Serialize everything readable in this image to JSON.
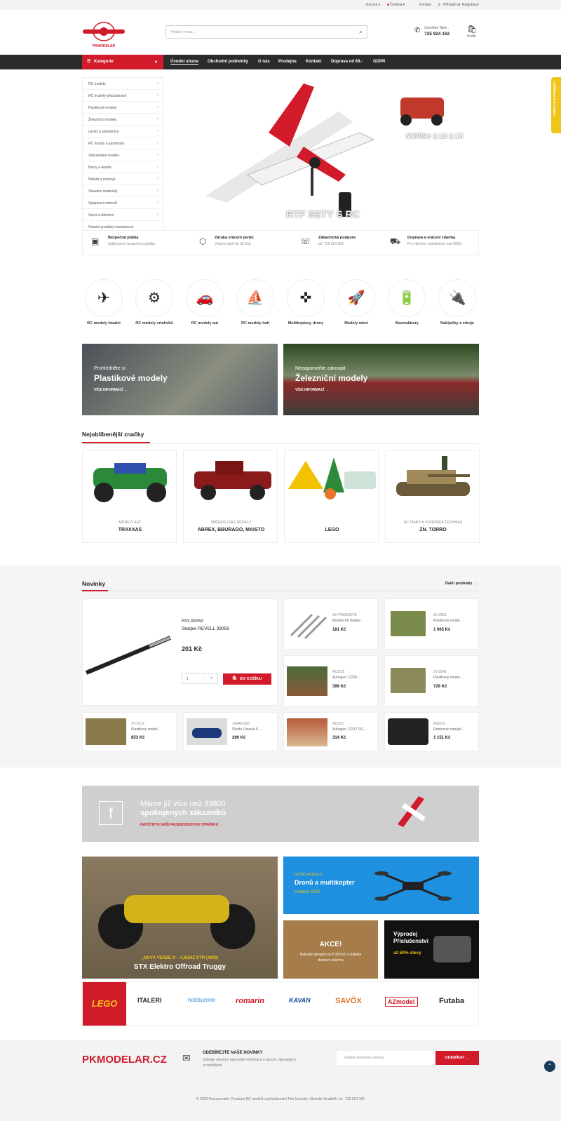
{
  "topbar": {
    "currency": "Koruna",
    "language": "Čeština",
    "contact": "Kontakt",
    "login": "Přihlásit se",
    "separator": "/",
    "register": "Registrace"
  },
  "header": {
    "logo_text": "PKMODELAR",
    "search_placeholder": "Hledaný výraz...",
    "phone_label": "Zavolejte Nám :",
    "phone": "725 924 162",
    "cart_label": "Košík"
  },
  "nav": {
    "categories_label": "Kategorie",
    "items": [
      "Úvodní strana",
      "Obchodní podmínky",
      "O nás",
      "Prodejna",
      "Kontakt",
      "Doprava od 69,-",
      "GDPR"
    ]
  },
  "sidemenu": [
    "RC modely",
    "RC modely-příslušenství",
    "Plastikové modely",
    "Železniční modely",
    "LEGO a stavebnice",
    "RC hračky a autodráhy",
    "Sběratelské modely",
    "Barvy a lepidla",
    "Nářadí a nástroje",
    "Stavební materiály",
    "Spojovací materiál",
    "Sport a oblečení",
    "Ostatní produkty-nezařazené"
  ],
  "hero": {
    "caption": "RTF SETY S RC",
    "side_caption": "Měřítko 1:12-1:18"
  },
  "features": [
    {
      "title": "Bezpečná platba",
      "text": "Zajišťujeme bezpečnou platbu"
    },
    {
      "title": "Záruka vrácení peněz",
      "text": "Vrácení zpět do 30 dnů"
    },
    {
      "title": "Zákaznická podpora",
      "text": "tel: 725 924 162"
    },
    {
      "title": "Doprava a vrácení zdarma",
      "text": "Pro všechny objednávky nad 5000,-"
    }
  ],
  "categories": [
    "RC modely letadel",
    "RC modely vrtulníků",
    "RC modely aut",
    "RC modely lodí",
    "Multikoptery, drony",
    "Modely raket",
    "Akumulátory",
    "Nabíječky a zdroje"
  ],
  "banners": [
    {
      "pre": "Prohlédněte si",
      "title": "Plastikové modely",
      "link": "VÍCE INFORMACÍ →"
    },
    {
      "pre": "Nezapomeňte zakoupit",
      "title": "Železniční modely",
      "link": "VÍCE INFORMACÍ →"
    }
  ],
  "brands_title": "Nejoblíbenější značky",
  "brands": [
    {
      "category": "MODELY AUT",
      "name": "TRAXXAS"
    },
    {
      "category": "SBĚRATELSKÉ MODELY",
      "name": "ABREX, BBURAGO, MAISTO"
    },
    {
      "category": "",
      "name": "LEGO"
    },
    {
      "category": "RC TANKY A VOJENSKÁ TECHNIKA",
      "name": "ZN. TORRO"
    }
  ],
  "news": {
    "title": "Novinky",
    "more": "Další produkty →",
    "featured": {
      "code": "RVL39059",
      "name": "Skalpel REVELL 39059",
      "price": "201 Kč",
      "qty": "1",
      "button": "DO KOŠÍKU"
    },
    "items": [
      {
        "code": "SH-PKM1007/3",
        "name": "Modelcraft skalpel ...",
        "price": "181 Kč"
      },
      {
        "code": "ZV-3601",
        "name": "Plastikový model...",
        "price": "1 065 Kč"
      },
      {
        "code": "A12225",
        "name": "Auhagen 12225...",
        "price": "399 Kč"
      },
      {
        "code": "ZV-3541",
        "name": "Plastikový model...",
        "price": "729 Kč"
      },
      {
        "code": "ZV-3572",
        "name": "Plastikový model...",
        "price": "853 Kč"
      },
      {
        "code": "143AB-005",
        "name": "Škoda Octavia II...",
        "price": "290 Kč"
      },
      {
        "code": "A12237",
        "name": "Auhagen 12237 DG...",
        "price": "314 Kč"
      },
      {
        "code": "805015",
        "name": "Robitronic nabíječ...",
        "price": "1 151 Kč"
      }
    ]
  },
  "facebook": {
    "line1": "Máme již více než 33800",
    "line2": "spokojených zákazníků",
    "link": "NAVŠTIVTE NAŠI FACEBOOKOVOU STRÁNKU →"
  },
  "promos": {
    "truggy_pre": "„NOVÁ VERZE 2“ - 2,4GHZ RTR (4WD)",
    "truggy_title": "STX Elektro Offroad Truggy",
    "drone_pre": "NOVÉ MODELY",
    "drone_title": "Dronů a multikopter",
    "drone_sub": "Kolekce 2022",
    "akce_title": "AKCE!",
    "akce_text": "Nakupte alespoň za 5 000 Kč a získejte dopravu zdarma",
    "sale_title": "Výprodej Příslušenství",
    "sale_sub": "až 50% slevy"
  },
  "logos": [
    "LEGO",
    "ITALERI",
    "hobbyzone",
    "romarin",
    "KAVAN",
    "SAVÖX",
    "AZmodel",
    "Futaba"
  ],
  "newsletter": {
    "brand": "PKMODELAR.CZ",
    "title": "ODEBÍREJTE NAŠE NOVINKY",
    "text": "Získejte všechny nejnovější informace o akcích, výprodejích a nabídkách.",
    "placeholder": "Zadejte emailovou adresu",
    "button": "ODEBÍRAT →"
  },
  "footer": {
    "text": "© 2022 Provozovatel: Prodejna RC modelů a příslušenství Petr Kunický, Uherské Hradiště, tel.: 725 924 162"
  },
  "side_tab": "OVĚŘENO ZÁKAZNÍKY",
  "colors": {
    "accent": "#d11a2a",
    "dark": "#2b2b2b",
    "facebook_bg": "#cfcfcf",
    "drone_bg": "#1f8fe0"
  }
}
